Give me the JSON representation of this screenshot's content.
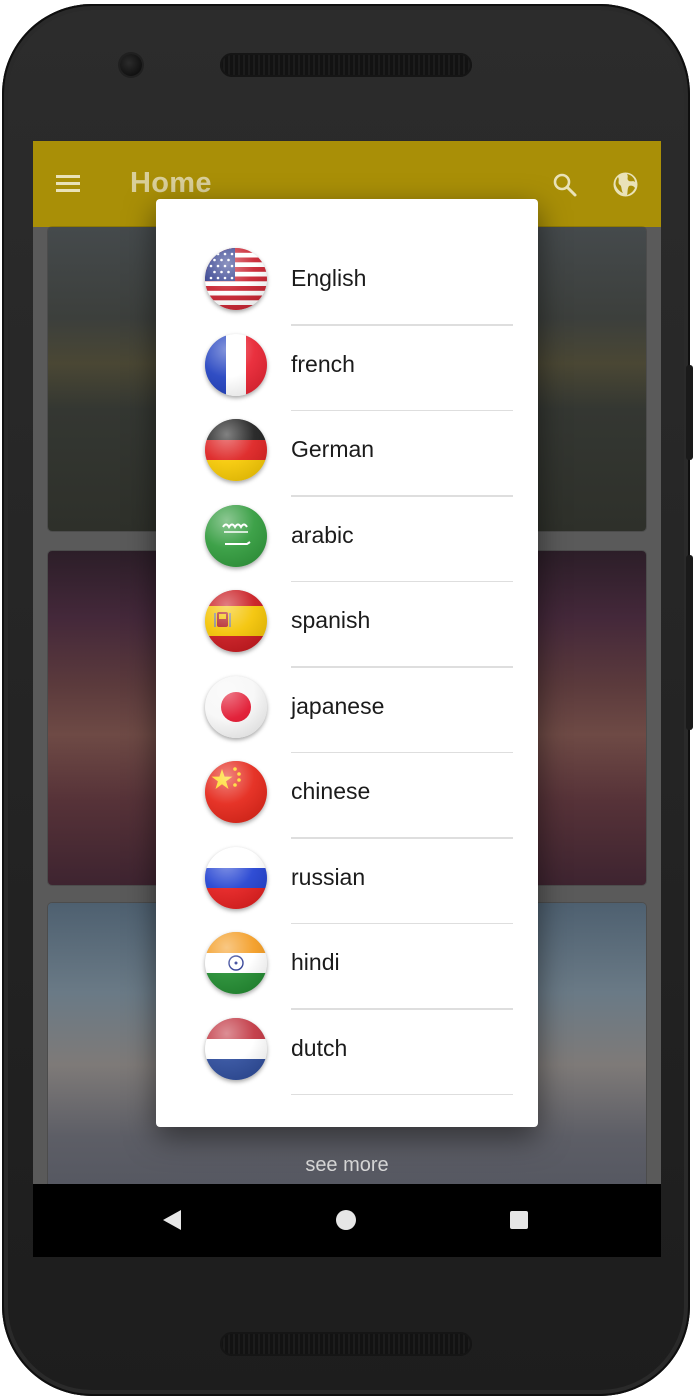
{
  "app": {
    "title": "Home",
    "accent_color": "#a98f07",
    "icons": {
      "menu": "menu-icon",
      "search": "search-icon",
      "language": "globe-icon"
    }
  },
  "content": {
    "see_more_label": "see more"
  },
  "language_dialog": {
    "items": [
      {
        "label": "English",
        "flag": "us-flag-icon"
      },
      {
        "label": "french",
        "flag": "france-flag-icon"
      },
      {
        "label": "German",
        "flag": "germany-flag-icon"
      },
      {
        "label": "arabic",
        "flag": "saudi-arabia-flag-icon"
      },
      {
        "label": "spanish",
        "flag": "spain-flag-icon"
      },
      {
        "label": "japanese",
        "flag": "japan-flag-icon"
      },
      {
        "label": "chinese",
        "flag": "china-flag-icon"
      },
      {
        "label": "russian",
        "flag": "russia-flag-icon"
      },
      {
        "label": "hindi",
        "flag": "india-flag-icon"
      },
      {
        "label": "dutch",
        "flag": "netherlands-flag-icon"
      }
    ]
  },
  "system_nav": {
    "icons": [
      "back-icon",
      "home-icon",
      "recents-icon"
    ]
  }
}
